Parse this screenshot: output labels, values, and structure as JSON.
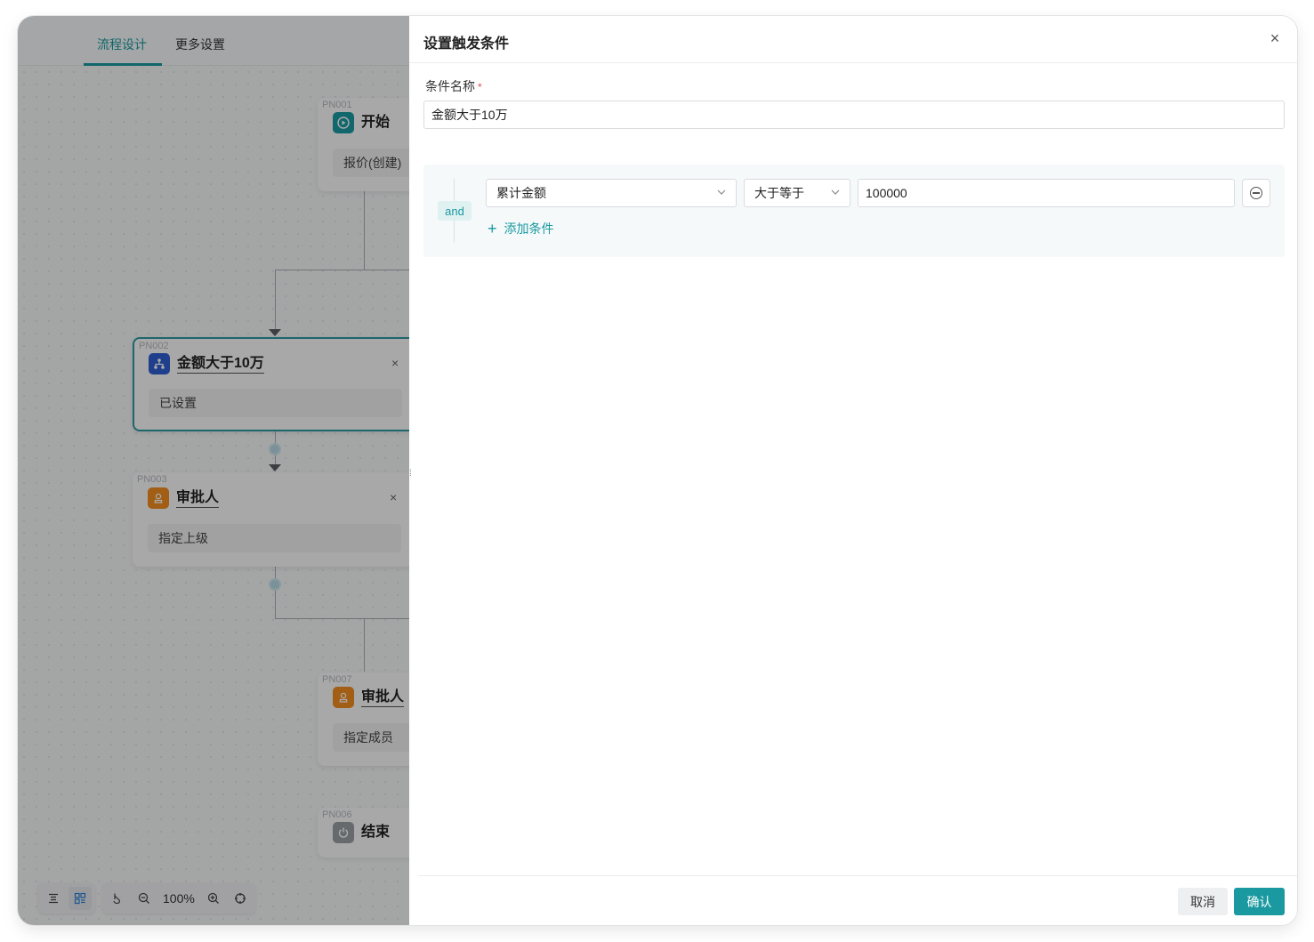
{
  "tabs": {
    "design": "流程设计",
    "settings": "更多设置"
  },
  "nodes": {
    "start": {
      "id": "PN001",
      "title": "开始",
      "body": "报价(创建)"
    },
    "condition": {
      "id": "PN002",
      "title": "金额大于10万",
      "body": "已设置",
      "close": "×"
    },
    "approver1": {
      "id": "PN003",
      "title": "审批人",
      "body": "指定上级",
      "close": "×"
    },
    "approver2": {
      "id": "PN007",
      "title": "审批人",
      "body": "指定成员"
    },
    "end": {
      "id": "PN006",
      "title": "结束"
    }
  },
  "toolbar": {
    "zoom": "100%"
  },
  "drawer": {
    "title": "设置触发条件",
    "close": "×",
    "name_label": "条件名称",
    "required_mark": "*",
    "name_value": "金额大于10万",
    "logic": "and",
    "condition": {
      "field": "累计金额",
      "operator": "大于等于",
      "value": "100000"
    },
    "add_condition": "添加条件",
    "cancel": "取消",
    "confirm": "确认"
  },
  "colors": {
    "accent": "#1a9aa0",
    "condition_icon": "#2f5fd1",
    "approver_icon": "#f08c1e",
    "start_icon": "#1a9aa0",
    "end_icon": "#9a9ea3"
  },
  "icons": {
    "start": "play-circle-icon",
    "condition": "branch-icon",
    "approver": "user-stamp-icon",
    "end": "power-icon"
  }
}
